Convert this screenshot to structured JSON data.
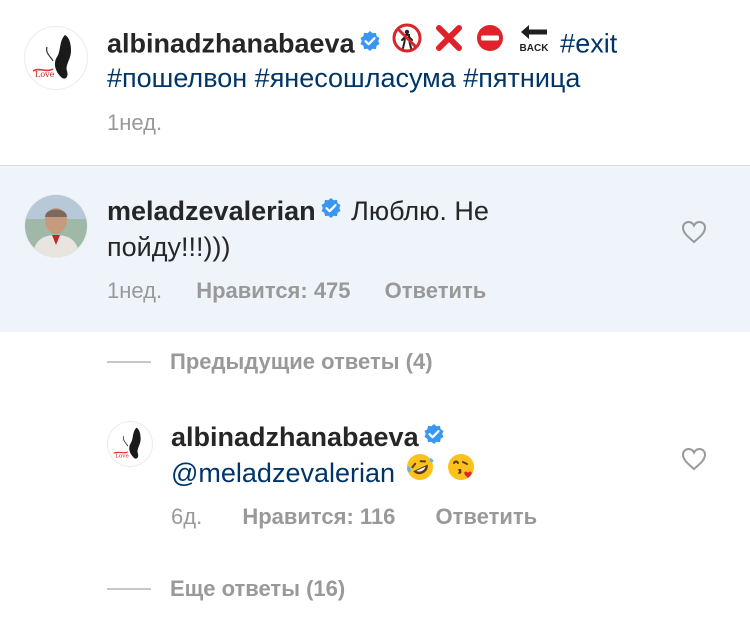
{
  "caption": {
    "username": "albinadzhanabaeva",
    "icons": [
      "no-pedestrians-icon",
      "cross-mark-icon",
      "no-entry-icon",
      "back-arrow-icon"
    ],
    "back_label": "BACK",
    "tag_exit": "#exit",
    "tags_line2": [
      "#пошелвон",
      "#янесошласума",
      "#пятница"
    ],
    "time": "1нед."
  },
  "comment": {
    "username": "meladzevalerian",
    "text_part1": "Люблю. Не",
    "text_part2": "пойду!!!)))",
    "time": "1нед.",
    "likes": "Нравится: 475",
    "reply": "Ответить"
  },
  "previous_replies": "Предыдущие ответы (4)",
  "reply": {
    "username": "albinadzhanabaeva",
    "mention": "@meladzevalerian",
    "emojis": [
      "rolling-laughing-emoji",
      "kissing-heart-emoji"
    ],
    "time": "6д.",
    "likes": "Нравится: 116",
    "reply": "Ответить"
  },
  "more_replies": "Еще ответы (16)",
  "colors": {
    "link": "#003569",
    "verified": "#3897f0",
    "meta": "#999999",
    "highlight": "#eff4fb"
  }
}
